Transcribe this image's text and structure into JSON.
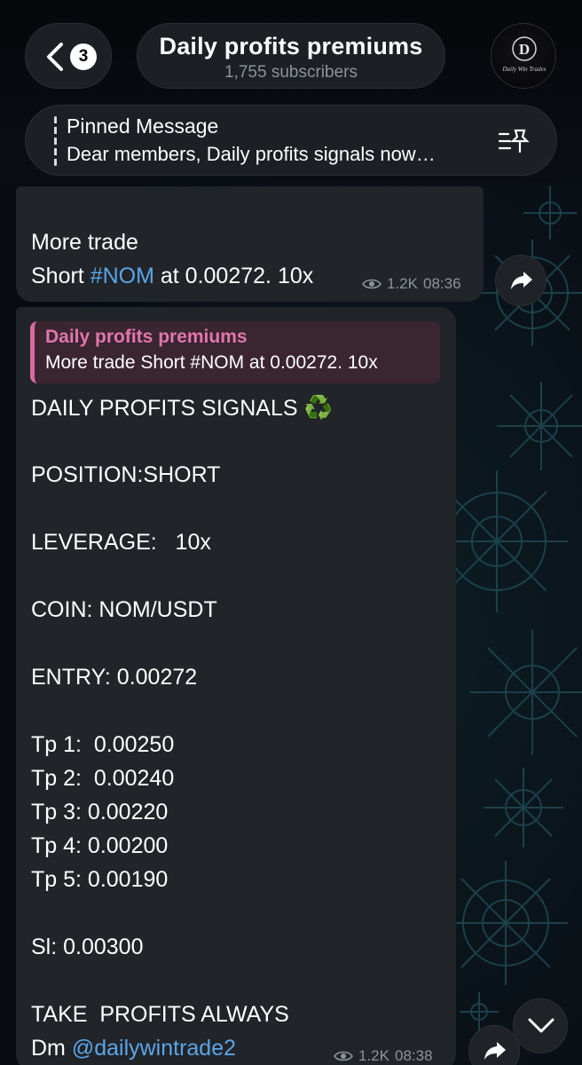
{
  "header": {
    "unread_count": "3",
    "channel_title": "Daily profits premiums",
    "subscribers": "1,755 subscribers",
    "avatar_letter": "D",
    "avatar_caption": "Daily Win Trades"
  },
  "pinned": {
    "label": "Pinned Message",
    "text": "Dear members, Daily profits signals now…"
  },
  "messages": [
    {
      "line1": "More trade",
      "prefix": "Short ",
      "hashtag": "#NOM",
      "suffix": " at 0.00272. 10x",
      "views": "1.2K",
      "time": "08:36"
    },
    {
      "reply_author": "Daily profits premiums",
      "reply_text": "More trade Short #NOM at 0.00272. 10x",
      "lines": [
        "DAILY PROFITS SIGNALS",
        "POSITION:SHORT",
        "LEVERAGE:   10x",
        "COIN: NOM/USDT",
        "ENTRY: 0.00272",
        "Tp 1:  0.00250",
        "Tp 2:  0.00240",
        "Tp 3: 0.00220",
        "Tp 4: 0.00200",
        "Tp 5: 0.00190",
        "Sl: 0.00300",
        "TAKE  PROFITS ALWAYS"
      ],
      "dm_prefix": "Dm ",
      "mention": "@dailywintrade2",
      "emoji": "♻️",
      "views": "1.2K",
      "time": "08:38"
    }
  ],
  "colors": {
    "link": "#5aa5e8",
    "reply_accent": "#d86a9f",
    "bubble": "#212429"
  },
  "icons": [
    "chevron-left-icon",
    "pinned-list-icon",
    "eye-icon",
    "share-icon",
    "chevron-down-icon"
  ]
}
